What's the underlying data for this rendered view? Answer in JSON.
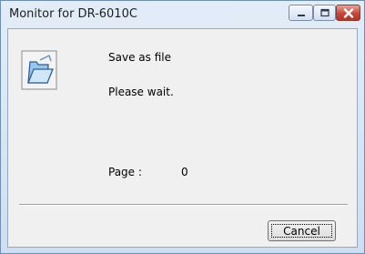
{
  "window": {
    "title": "Monitor for DR-6010C",
    "controls": {
      "minimize": "minimize-icon",
      "maximize": "maximize-icon",
      "close": "close-icon"
    }
  },
  "dialog": {
    "icon": "folder-icon",
    "status": "Save as file",
    "message": "Please wait.",
    "page_label": "Page :",
    "page_value": "0",
    "cancel_label": "Cancel"
  }
}
